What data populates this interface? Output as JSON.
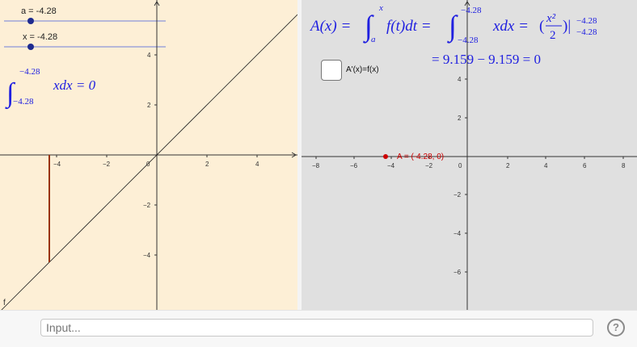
{
  "sliders": {
    "a_label": "a = -4.28",
    "x_label": "x = -4.28"
  },
  "left_view": {
    "integral_upper": "−4.28",
    "integral_lower": "−4.28",
    "integrand": "xdx = 0",
    "curve_label": "f",
    "x_ticks": [
      "−4",
      "−2",
      "0",
      "2",
      "4"
    ],
    "y_ticks": [
      "4",
      "2",
      "−2",
      "−4"
    ]
  },
  "right_view": {
    "formula_lhs": "A(x) =",
    "formula_int_upper": "x",
    "formula_int_lower": "a",
    "formula_ft": "f(t)dt =",
    "formula_int2_upper": "−4.28",
    "formula_int2_lower": "−4.28",
    "formula_int2_body": "xdx =",
    "formula_frac_num": "x²",
    "formula_frac_den": "2",
    "formula_eval_upper": "−4.28",
    "formula_eval_lower": "−4.28",
    "formula_result": "= 9.159 − 9.159 = 0",
    "checkbox_label": "A'(x)=f(x)",
    "checkbox_checked": false,
    "point_label": "A = (-4.28, 0)",
    "point_color": "#cc0000",
    "x_ticks": [
      "−8",
      "−6",
      "−4",
      "−2",
      "0",
      "2",
      "4",
      "6",
      "8"
    ],
    "y_ticks": [
      "4",
      "2",
      "−2",
      "−4",
      "−6"
    ]
  },
  "input_bar": {
    "placeholder": "Input..."
  },
  "colors": {
    "math_text": "#2020e0",
    "slider_line": "#6f7fd9",
    "segment": "#993300"
  }
}
